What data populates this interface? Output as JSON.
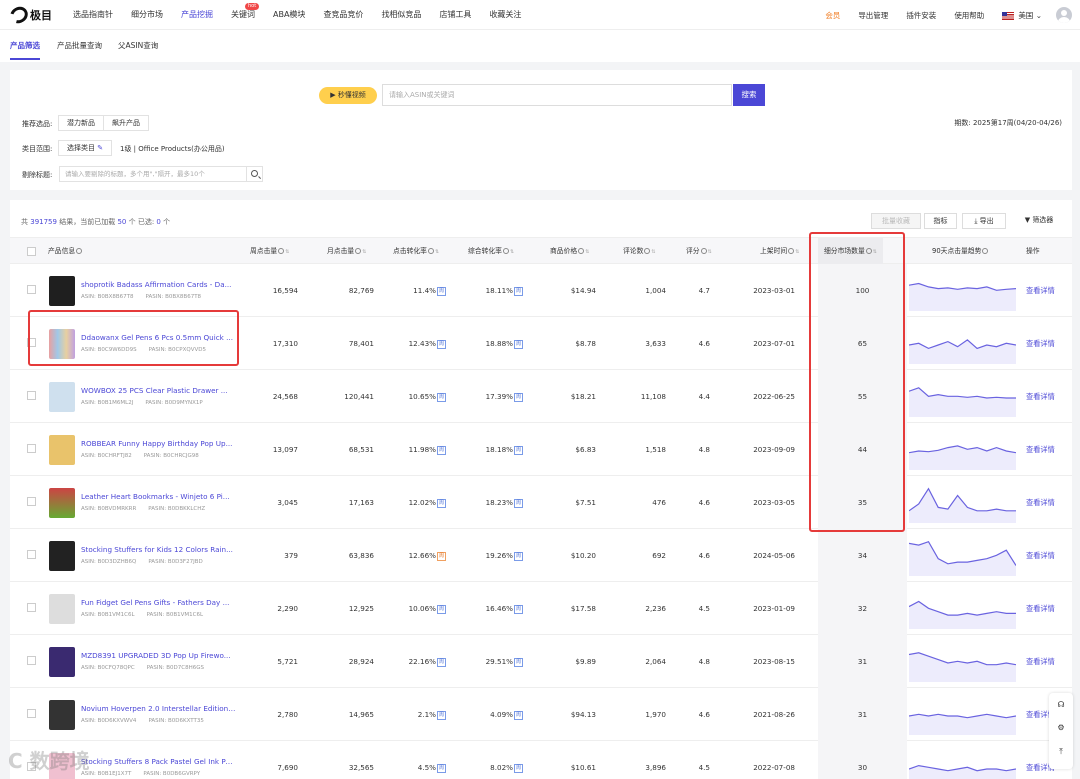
{
  "nav": {
    "logo": "极目",
    "items": [
      "选品指南针",
      "细分市场",
      "产品挖掘",
      "关键词",
      "ABA模块",
      "查竞品竞价",
      "找相似竞品",
      "店铺工具",
      "收藏关注"
    ],
    "active_index": 2,
    "hot_badge": "hot",
    "right": [
      "会员",
      "导出管理",
      "插件安装",
      "使用帮助"
    ],
    "country": "美国"
  },
  "subtabs": [
    "产品筛选",
    "产品批量查询",
    "父ASIN查询"
  ],
  "search": {
    "video_label": "秒懂视频",
    "placeholder": "请输入ASIN或关键词",
    "button": "搜索"
  },
  "filters": {
    "recommend_label": "推荐选品:",
    "recommend_opts": [
      "潜力新品",
      "飙升产品"
    ],
    "category_label": "类目范围:",
    "category_btn": "选择类目",
    "category_value": "1级 | Office Products(办公用品)",
    "exclude_label": "剔除标题:",
    "exclude_placeholder": "请输入要剔除的标题，多个用\",\"隔开，最多10个",
    "period": "期数: 2025第17周(04/20-04/26)"
  },
  "results": {
    "prefix": "共",
    "total": "391759",
    "mid": "结果，当前已加载",
    "loaded": "50",
    "mid2": "个  已选:",
    "selected": "0",
    "suffix": "个",
    "btn_batch": "批量收藏",
    "btn_metrics": "指标",
    "btn_export": "导出",
    "btn_filter": "筛选器"
  },
  "columns": [
    "产品信息",
    "周点击量",
    "月点击量",
    "点击转化率",
    "综合转化率",
    "商品价格",
    "评论数",
    "评分",
    "上架时间",
    "细分市场数量",
    "90天点击量趋势",
    "操作"
  ],
  "detail_label": "查看详情",
  "rows": [
    {
      "title": "shoprotik Badass Affirmation Cards - Da...",
      "asin": "ASIN: B0BX8B67T8",
      "pasin": "PASIN: B0BX8B67T8",
      "weekly": "16,594",
      "monthly": "82,769",
      "ctr": "11.4%",
      "conv": "18.11%",
      "price": "$14.94",
      "reviews": "1,004",
      "rating": "4.7",
      "date": "2023-03-01",
      "seg": "100",
      "ctr_badge": "周",
      "conv_badge": "周",
      "trend": [
        0.7,
        0.75,
        0.65,
        0.6,
        0.62,
        0.58,
        0.62,
        0.6,
        0.65,
        0.55,
        0.58,
        0.6
      ]
    },
    {
      "title": "Ddaowanx Gel Pens 6 Pcs 0.5mm Quick ...",
      "asin": "ASIN: B0C9W6DD9S",
      "pasin": "PASIN: B0CPXQVVD5",
      "weekly": "17,310",
      "monthly": "78,401",
      "ctr": "12.43%",
      "conv": "18.88%",
      "price": "$8.78",
      "reviews": "3,633",
      "rating": "4.6",
      "date": "2023-07-01",
      "seg": "65",
      "ctr_badge": "周",
      "conv_badge": "周",
      "trend": [
        0.5,
        0.55,
        0.4,
        0.5,
        0.6,
        0.45,
        0.65,
        0.4,
        0.5,
        0.45,
        0.55,
        0.5
      ]
    },
    {
      "title": "WOWBOX 25 PCS Clear Plastic Drawer ...",
      "asin": "ASIN: B0B1M6ML2J",
      "pasin": "PASIN: B0D9MYNX1P",
      "weekly": "24,568",
      "monthly": "120,441",
      "ctr": "10.65%",
      "conv": "17.39%",
      "price": "$18.21",
      "reviews": "11,108",
      "rating": "4.4",
      "date": "2022-06-25",
      "seg": "55",
      "ctr_badge": "周",
      "conv_badge": "周",
      "trend": [
        0.7,
        0.8,
        0.55,
        0.6,
        0.55,
        0.55,
        0.52,
        0.55,
        0.5,
        0.52,
        0.5,
        0.5
      ]
    },
    {
      "title": "ROBBEAR Funny Happy Birthday Pop Up...",
      "asin": "ASIN: B0CHRFTJ82",
      "pasin": "PASIN: B0CHRCJG98",
      "weekly": "13,097",
      "monthly": "68,531",
      "ctr": "11.98%",
      "conv": "18.18%",
      "price": "$6.83",
      "reviews": "1,518",
      "rating": "4.8",
      "date": "2023-09-09",
      "seg": "44",
      "ctr_badge": "周",
      "conv_badge": "周",
      "trend": [
        0.45,
        0.5,
        0.48,
        0.52,
        0.6,
        0.65,
        0.55,
        0.6,
        0.5,
        0.6,
        0.5,
        0.45
      ]
    },
    {
      "title": "Leather Heart Bookmarks - Winjeto 6 Pi...",
      "asin": "ASIN: B0BVDMRKRR",
      "pasin": "PASIN: B0DBKKLCHZ",
      "weekly": "3,045",
      "monthly": "17,163",
      "ctr": "12.02%",
      "conv": "18.23%",
      "price": "$7.51",
      "reviews": "476",
      "rating": "4.6",
      "date": "2023-03-05",
      "seg": "35",
      "ctr_badge": "周",
      "conv_badge": "周",
      "trend": [
        0.3,
        0.5,
        0.95,
        0.4,
        0.35,
        0.75,
        0.4,
        0.3,
        0.3,
        0.35,
        0.3,
        0.3
      ]
    },
    {
      "title": "Stocking Stuffers for Kids 12 Colors Rain...",
      "asin": "ASIN: B0D3DZHB6Q",
      "pasin": "PASIN: B0D3F27JBD",
      "weekly": "379",
      "monthly": "63,836",
      "ctr": "12.66%",
      "conv": "19.26%",
      "price": "$10.20",
      "reviews": "692",
      "rating": "4.6",
      "date": "2024-05-06",
      "seg": "34",
      "ctr_badge": "周",
      "conv_badge": "周",
      "ctr_orange": true,
      "trend": [
        0.9,
        0.85,
        0.95,
        0.45,
        0.3,
        0.35,
        0.35,
        0.4,
        0.45,
        0.55,
        0.7,
        0.25
      ]
    },
    {
      "title": "Fun Fidget Gel Pens Gifts - Fathers Day ...",
      "asin": "ASIN: B0B1VM1C6L",
      "pasin": "PASIN: B0B1VM1C6L",
      "weekly": "2,290",
      "monthly": "12,925",
      "ctr": "10.06%",
      "conv": "16.46%",
      "price": "$17.58",
      "reviews": "2,236",
      "rating": "4.5",
      "date": "2023-01-09",
      "seg": "32",
      "ctr_badge": "周",
      "conv_badge": "周",
      "trend": [
        0.6,
        0.75,
        0.55,
        0.45,
        0.35,
        0.35,
        0.4,
        0.35,
        0.4,
        0.45,
        0.4,
        0.4
      ]
    },
    {
      "title": "MZD8391 UPGRADED 3D Pop Up Firewo...",
      "asin": "ASIN: B0CFQ78QPC",
      "pasin": "PASIN: B0D7C8H6GS",
      "weekly": "5,721",
      "monthly": "28,924",
      "ctr": "22.16%",
      "conv": "29.51%",
      "price": "$9.89",
      "reviews": "2,064",
      "rating": "4.8",
      "date": "2023-08-15",
      "seg": "31",
      "ctr_badge": "周",
      "conv_badge": "周",
      "trend": [
        0.75,
        0.8,
        0.7,
        0.6,
        0.5,
        0.55,
        0.5,
        0.55,
        0.45,
        0.45,
        0.5,
        0.45
      ]
    },
    {
      "title": "Novium Hoverpen 2.0 Interstellar Edition ...",
      "asin": "ASIN: B0D6KXVWV4",
      "pasin": "PASIN: B0D6KXTT35",
      "weekly": "2,780",
      "monthly": "14,965",
      "ctr": "2.1%",
      "conv": "4.09%",
      "price": "$94.13",
      "reviews": "1,970",
      "rating": "4.6",
      "date": "2021-08-26",
      "seg": "31",
      "ctr_badge": "周",
      "conv_badge": "周",
      "trend": [
        0.5,
        0.55,
        0.5,
        0.55,
        0.5,
        0.5,
        0.45,
        0.5,
        0.55,
        0.5,
        0.45,
        0.5
      ]
    },
    {
      "title": "Stocking Stuffers 8 Pack Pastel Gel Ink Pen ...",
      "asin": "ASIN: B0B1EJ1X7T",
      "pasin": "PASIN: B0DB6GVRPY",
      "weekly": "7,690",
      "monthly": "32,565",
      "ctr": "4.5%",
      "conv": "8.02%",
      "price": "$10.61",
      "reviews": "3,896",
      "rating": "4.5",
      "date": "2022-07-08",
      "seg": "30",
      "ctr_badge": "周",
      "conv_badge": "周",
      "trend": [
        0.5,
        0.6,
        0.55,
        0.5,
        0.45,
        0.5,
        0.55,
        0.45,
        0.5,
        0.5,
        0.45,
        0.5
      ]
    }
  ],
  "watermark": "C 数跨境",
  "colors": {
    "accent": "#4b47d6",
    "highlight": "#e53a3a"
  }
}
